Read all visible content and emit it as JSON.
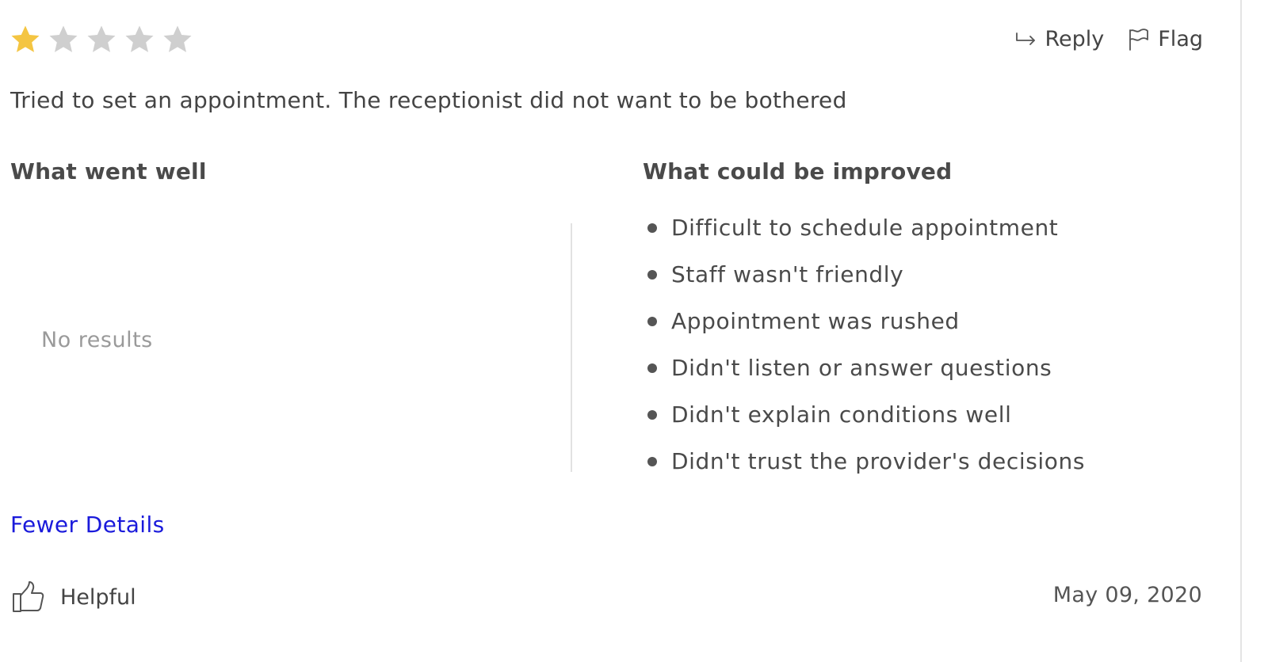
{
  "rating": {
    "value": 1,
    "max": 5,
    "filled_color": "#f4c542",
    "empty_color": "#cfcfcf"
  },
  "actions": {
    "reply_label": "Reply",
    "flag_label": "Flag"
  },
  "review": {
    "text": "Tried to set an appointment. The receptionist did not want to be bothered"
  },
  "went_well": {
    "title": "What went well",
    "empty_text": "No results"
  },
  "could_improve": {
    "title": "What could be improved",
    "items": [
      "Difficult to schedule appointment",
      "Staff wasn't friendly",
      "Appointment was rushed",
      "Didn't listen or answer questions",
      "Didn't explain conditions well",
      "Didn't trust the provider's decisions"
    ]
  },
  "links": {
    "fewer_details": "Fewer Details",
    "link_color": "#1a1adb"
  },
  "footer": {
    "helpful_label": "Helpful",
    "date": "May 09, 2020"
  },
  "icons": {
    "reply": "reply-arrow-icon",
    "flag": "flag-icon",
    "helpful": "thumbs-up-icon",
    "star": "star-icon"
  }
}
